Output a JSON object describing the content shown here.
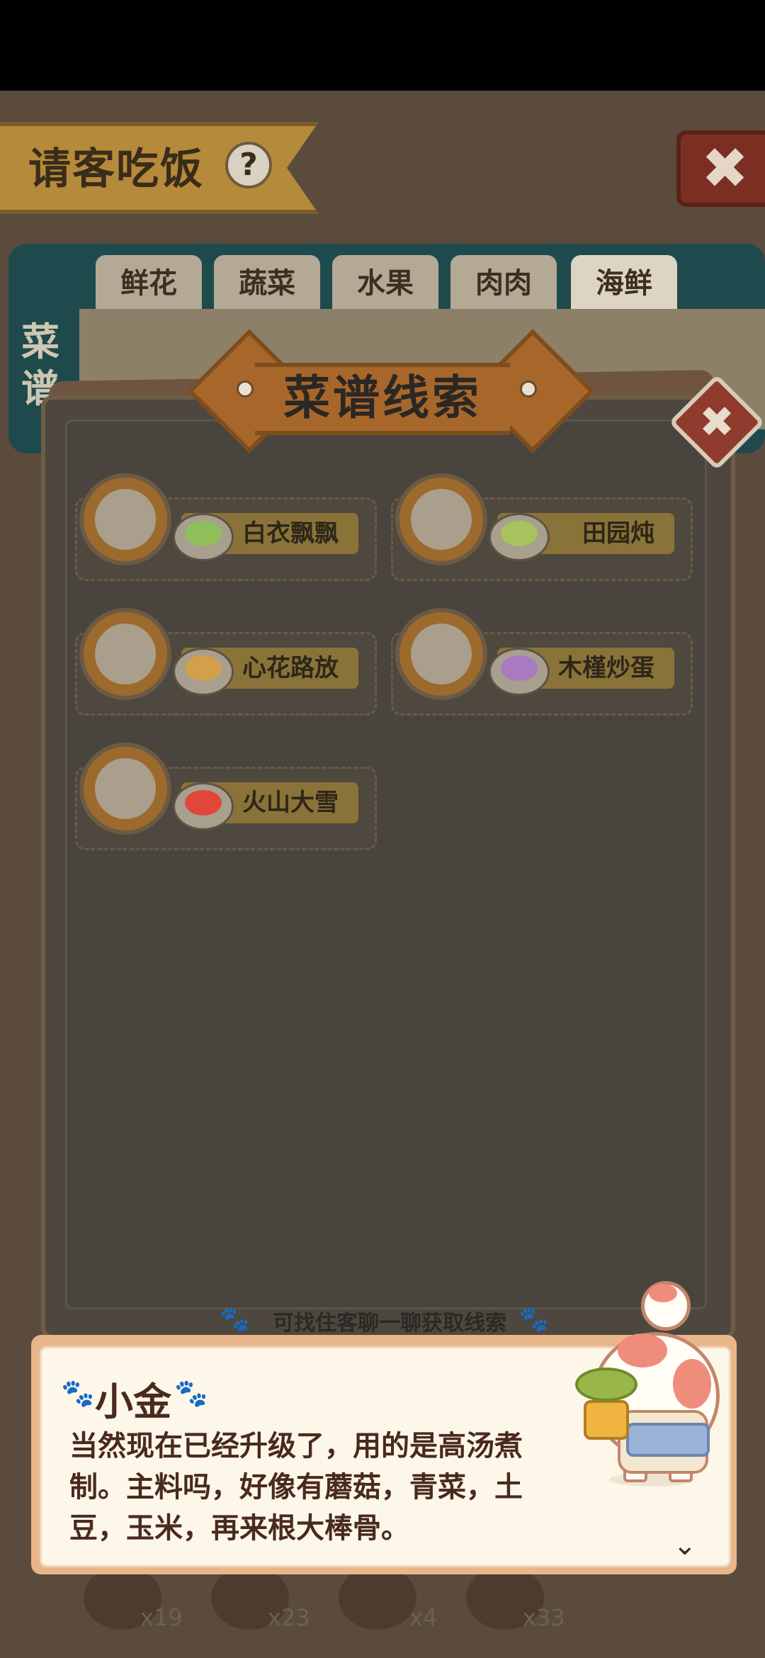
{
  "header": {
    "title": "请客吃饭",
    "help_glyph": "?",
    "close_glyph": "✖"
  },
  "categories": {
    "tabs": [
      {
        "label": "鲜花"
      },
      {
        "label": "蔬菜"
      },
      {
        "label": "水果"
      },
      {
        "label": "肉肉"
      },
      {
        "label": "海鲜",
        "active": true
      }
    ],
    "side_label": "菜谱"
  },
  "inventory": {
    "counts": [
      "x19",
      "x23",
      "x4",
      "x33"
    ]
  },
  "modal": {
    "title": "菜谱线索",
    "close_glyph": "✖",
    "clues": [
      {
        "name": "白衣飘飘",
        "avatar": "ghost-chick-icon",
        "dish_color": "#8fbf5a"
      },
      {
        "name": "田园炖",
        "avatar": "spotted-cat-icon",
        "dish_color": "#a7c35d"
      },
      {
        "name": "心花路放",
        "avatar": "ghost-chick-icon",
        "dish_color": "#d2a04a"
      },
      {
        "name": "木槿炒蛋",
        "avatar": "bear-icon",
        "dish_color": "#a77ac2"
      },
      {
        "name": "火山大雪",
        "avatar": "ghost-chick-icon",
        "dish_color": "#e0473a"
      }
    ],
    "hint": "可找住客聊一聊获取线索"
  },
  "dialog": {
    "speaker": "小金",
    "text": "当然现在已经升级了，用的是高汤煮制。主料吗，好像有蘑菇，青菜，土豆，玉米，再来根大棒骨。",
    "next_glyph": "⌄"
  },
  "colors": {
    "accent": "#a8672a",
    "dialog_border": "#e9b68a",
    "dialog_bg": "#fdf7ea",
    "text_dark": "#4a2a1e"
  }
}
